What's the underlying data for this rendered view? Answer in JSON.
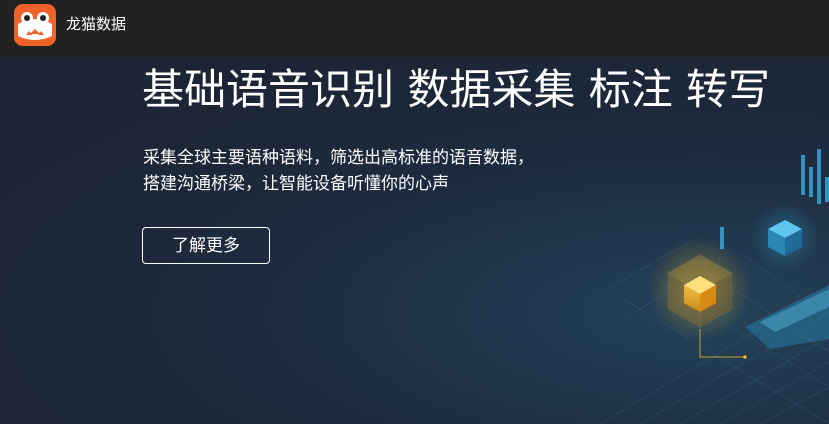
{
  "header": {
    "brand_name": "龙猫数据",
    "logo_icon": "longmao-cat-logo",
    "background_color": "#222222",
    "logo_color": "#f0622c"
  },
  "hero": {
    "title": "基础语音识别 数据采集 标注 转写",
    "description_lines": [
      "采集全球主要语种语料，筛选出高标准的语音数据，",
      "搭建沟通桥梁，让智能设备听懂你的心声"
    ],
    "cta_label": "了解更多",
    "background_color": "#1c2535",
    "accent_color": "#f5b82a",
    "secondary_accent_color": "#2f9fd0"
  }
}
